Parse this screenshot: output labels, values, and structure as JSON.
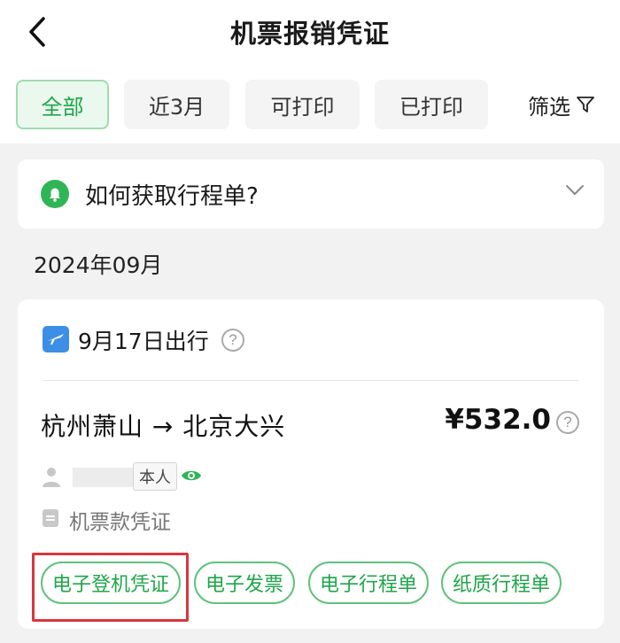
{
  "header": {
    "title": "机票报销凭证",
    "back_icon": "chevron-left-icon"
  },
  "filters": {
    "tabs": [
      {
        "label": "全部",
        "active": true
      },
      {
        "label": "近3月",
        "active": false
      },
      {
        "label": "可打印",
        "active": false
      },
      {
        "label": "已打印",
        "active": false
      }
    ],
    "filter_label": "筛选",
    "filter_icon": "funnel-icon"
  },
  "notice": {
    "text": "如何获取行程单?",
    "icon": "bell-icon",
    "expand_icon": "chevron-down-icon"
  },
  "month_label": "2024年09月",
  "trip": {
    "date_label": "9月17日出行",
    "route": "杭州萧山 → 北京大兴",
    "price": "¥532.0",
    "self_tag": "本人",
    "voucher_label": "机票款凭证",
    "documents": [
      "电子登机凭证",
      "电子发票",
      "电子行程单",
      "纸质行程单"
    ],
    "highlighted_document": "电子登机凭证"
  },
  "colors": {
    "accent": "#1fa64a",
    "accent_border": "#5fc27c",
    "highlight": "#d9363e",
    "plane_blue": "#3d8fe6"
  }
}
